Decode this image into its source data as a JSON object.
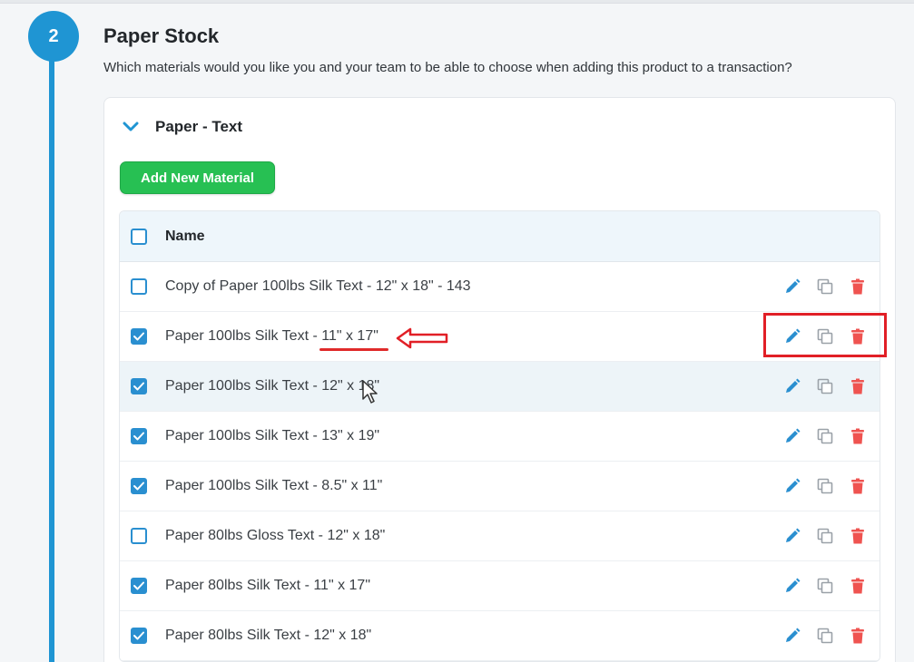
{
  "step": {
    "number": "2",
    "title": "Paper Stock",
    "description": "Which materials would you like you and your team to be able to choose when adding this product to a transaction?"
  },
  "group": {
    "title": "Paper - Text",
    "expanded": true,
    "add_button_label": "Add New Material"
  },
  "table": {
    "column_name": "Name",
    "header_checked": false,
    "rows": [
      {
        "name": "Copy of Paper 100lbs Silk Text - 12\" x 18\" - 143",
        "checked": false
      },
      {
        "name": "Paper 100lbs Silk Text - 11\" x 17\"",
        "checked": true
      },
      {
        "name": "Paper 100lbs Silk Text - 12\" x 18\"",
        "checked": true
      },
      {
        "name": "Paper 100lbs Silk Text - 13\" x 19\"",
        "checked": true
      },
      {
        "name": "Paper 100lbs Silk Text - 8.5\" x 11\"",
        "checked": true
      },
      {
        "name": "Paper 80lbs Gloss Text - 12\" x 18\"",
        "checked": false
      },
      {
        "name": "Paper 80lbs Silk Text - 11\" x 17\"",
        "checked": true
      },
      {
        "name": "Paper 80lbs Silk Text - 12\" x 18\"",
        "checked": true
      }
    ]
  },
  "icons": {
    "edit": "pencil-icon",
    "duplicate": "copy-icon",
    "delete": "trash-icon",
    "expand": "chevron-down-icon"
  },
  "colors": {
    "accent": "#1f95d3",
    "add_button": "#27c053",
    "checkbox": "#2a8fd0",
    "edit_icon": "#2a8fd0",
    "delete_icon": "#ef5350",
    "annotation": "#e11f26"
  }
}
